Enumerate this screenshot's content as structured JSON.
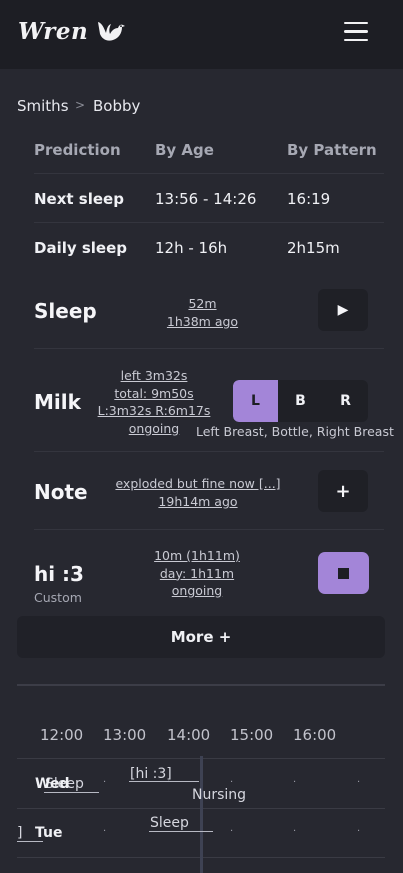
{
  "app": {
    "name": "Wren",
    "logo_icon": "bird-icon",
    "menu_icon": "hamburger-icon"
  },
  "breadcrumb": {
    "family": "Smiths",
    "child": "Bobby",
    "separator": ">"
  },
  "prediction_table": {
    "headers": [
      "Prediction",
      "By Age",
      "By Pattern"
    ],
    "rows": [
      {
        "label": "Next sleep",
        "by_age": "13:56 - 14:26",
        "by_pattern": "16:19"
      },
      {
        "label": "Daily sleep",
        "by_age": "12h - 16h",
        "by_pattern": "2h15m"
      }
    ]
  },
  "activities": {
    "sleep": {
      "title": "Sleep",
      "duration": "52m",
      "ago": "1h38m ago",
      "button_icon": "play-icon",
      "button_glyph": "▶"
    },
    "milk": {
      "title": "Milk",
      "lines": [
        "left 3m32s",
        "total: 9m50s",
        "L:3m32s R:6m17s",
        "ongoing"
      ],
      "options": [
        "L",
        "B",
        "R"
      ],
      "selected": "L",
      "legend": "Left Breast, Bottle, Right Breast"
    },
    "note": {
      "title": "Note",
      "text": "exploded but fine now [...]",
      "ago": "19h14m ago",
      "button_icon": "plus-icon",
      "button_glyph": "+"
    },
    "custom": {
      "title": "hi :3",
      "subtitle": "Custom",
      "lines": [
        "10m (1h11m)",
        "day: 1h11m",
        "ongoing"
      ],
      "button_icon": "stop-icon"
    }
  },
  "more_button": "More +",
  "timeline": {
    "hours": [
      "12:00",
      "13:00",
      "14:00",
      "15:00",
      "16:00"
    ],
    "rows": [
      {
        "day": "Wed",
        "events": [
          "Sleep",
          "[hi :3]",
          "Nursing"
        ]
      },
      {
        "day": "Tue",
        "events": [
          "]",
          "Sleep"
        ]
      }
    ],
    "tick": "."
  },
  "colors": {
    "background": "#272830",
    "topbar": "#1d1e24",
    "accent": "#a385d8",
    "button": "#1f2026"
  }
}
